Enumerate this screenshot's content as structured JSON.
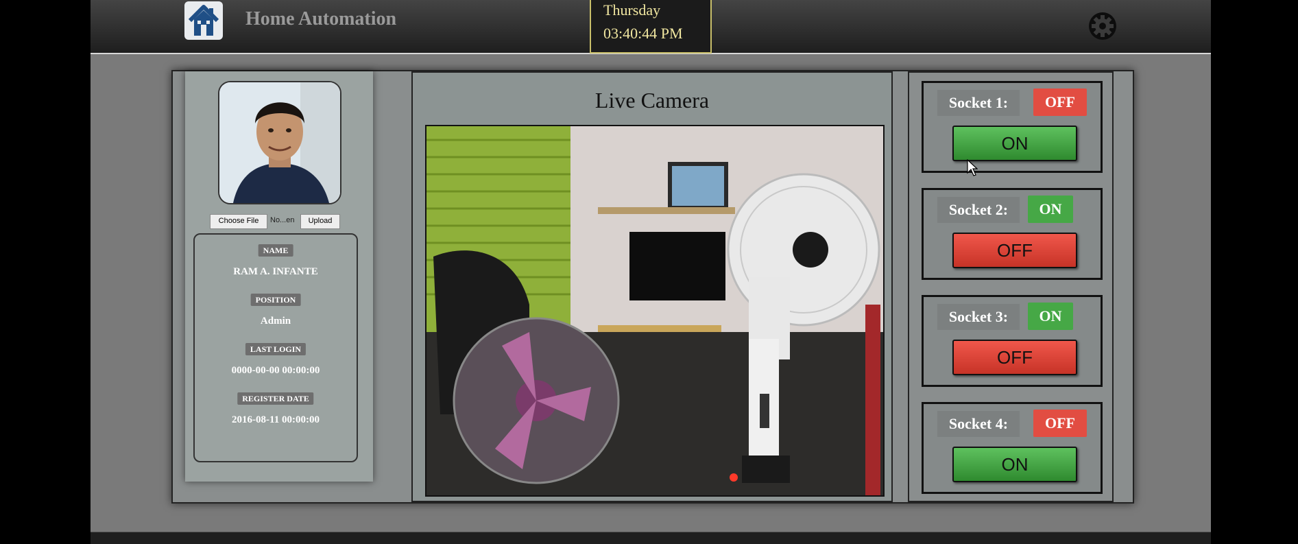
{
  "header": {
    "title": "Home Automation",
    "clock_day": "Thursday",
    "clock_time": "03:40:44 PM"
  },
  "profile": {
    "choose_file_label": "Choose File",
    "file_name": "No...en",
    "upload_label": "Upload",
    "name_label": "NAME",
    "name_value": "RAM A. INFANTE",
    "position_label": "POSITION",
    "position_value": "Admin",
    "last_login_label": "LAST LOGIN",
    "last_login_value": "0000-00-00 00:00:00",
    "register_label": "REGISTER DATE",
    "register_value": "2016-08-11 00:00:00"
  },
  "camera": {
    "title": "Live Camera"
  },
  "sockets": [
    {
      "label": "Socket 1:",
      "status": "OFF",
      "button": "ON"
    },
    {
      "label": "Socket 2:",
      "status": "ON",
      "button": "OFF"
    },
    {
      "label": "Socket 3:",
      "status": "ON",
      "button": "OFF"
    },
    {
      "label": "Socket 4:",
      "status": "OFF",
      "button": "ON"
    }
  ],
  "colors": {
    "status_on": "#46a846",
    "status_off": "#e24d42",
    "clock_border": "#c9bf6a"
  }
}
